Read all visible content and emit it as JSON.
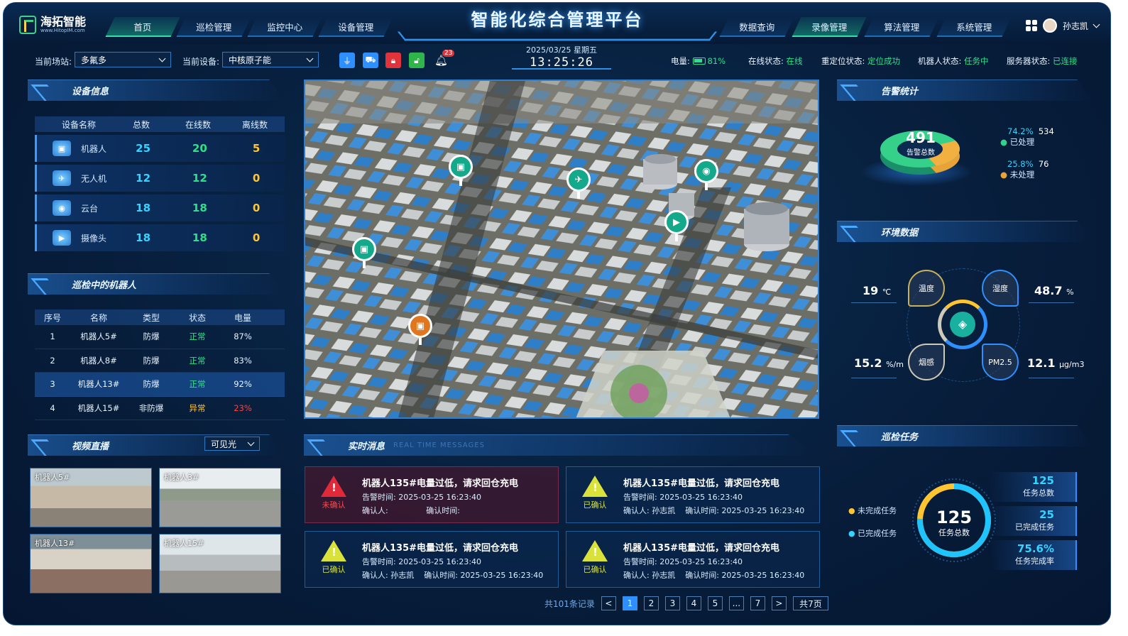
{
  "brand": {
    "name": "海拓智能",
    "url": "www.HitopIM.com"
  },
  "title": "智能化综合管理平台",
  "nav": {
    "left": [
      "首页",
      "巡检管理",
      "监控中心",
      "设备管理"
    ],
    "right": [
      "数据查询",
      "录像管理",
      "算法管理",
      "系统管理"
    ],
    "active": "首页",
    "active_right": "录像管理"
  },
  "user": {
    "name": "孙志凯"
  },
  "toolbar": {
    "site_label": "当前场站:",
    "site_value": "多氟多",
    "device_label": "当前设备:",
    "device_value": "中核原子能",
    "notification_count": "23"
  },
  "clock": {
    "date": "2025/03/25 星期五",
    "time": "13:25:26"
  },
  "status": {
    "power_label": "电量:",
    "power_value": "81%",
    "online_label": "在线状态:",
    "online_value": "在线",
    "relocate_label": "重定位状态:",
    "relocate_value": "定位成功",
    "robot_label": "机器人状态:",
    "robot_value": "任务中",
    "server_label": "服务器状态:",
    "server_value": "已连接"
  },
  "device_info": {
    "title": "设备信息",
    "headers": [
      "设备名称",
      "总数",
      "在线数",
      "离线数"
    ],
    "rows": [
      {
        "icon": "robot-icon",
        "name": "机器人",
        "total": "25",
        "online": "20",
        "offline": "5"
      },
      {
        "icon": "drone-icon",
        "name": "无人机",
        "total": "12",
        "online": "12",
        "offline": "0"
      },
      {
        "icon": "ptz-icon",
        "name": "云台",
        "total": "18",
        "online": "18",
        "offline": "0"
      },
      {
        "icon": "camera-icon",
        "name": "摄像头",
        "total": "18",
        "online": "18",
        "offline": "0"
      }
    ]
  },
  "robots": {
    "title": "巡检中的机器人",
    "headers": [
      "序号",
      "名称",
      "类型",
      "状态",
      "电量"
    ],
    "rows": [
      {
        "no": "1",
        "name": "机器人5#",
        "type": "防爆",
        "status": "正常",
        "power": "87%"
      },
      {
        "no": "2",
        "name": "机器人8#",
        "type": "防爆",
        "status": "正常",
        "power": "83%"
      },
      {
        "no": "3",
        "name": "机器人13#",
        "type": "防爆",
        "status": "正常",
        "power": "92%"
      },
      {
        "no": "4",
        "name": "机器人15#",
        "type": "非防爆",
        "status": "异常",
        "power": "23%"
      }
    ]
  },
  "video": {
    "title": "视频直播",
    "mode": "可见光",
    "feeds": [
      "机器人5#",
      "机器人3#",
      "机器人13#",
      "机器人15#"
    ]
  },
  "messages": {
    "title": "实时消息",
    "subtitle": "REAL TIME MESSAGES",
    "items": [
      {
        "state": "未确认",
        "title": "机器人135#电量过低，请求回仓充电",
        "line1": "告警时间:  2025-03-25  16:23:40",
        "confirm_label": "确认人:",
        "confirm_time_label": "确认时间:",
        "confirmer": "",
        "confirm_time": ""
      },
      {
        "state": "已确认",
        "title": "机器人135#电量过低，请求回仓充电",
        "line1": "告警时间:  2025-03-25  16:23:40",
        "confirm_label": "确认人:",
        "confirm_time_label": "确认时间:",
        "confirmer": "孙志凯",
        "confirm_time": "2025-03-25  16:23:40"
      },
      {
        "state": "已确认",
        "title": "机器人135#电量过低，请求回仓充电",
        "line1": "告警时间:  2025-03-25  16:23:40",
        "confirm_label": "确认人:",
        "confirm_time_label": "确认时间:",
        "confirmer": "孙志凯",
        "confirm_time": "2025-03-25  16:23:40"
      },
      {
        "state": "已确认",
        "title": "机器人135#电量过低，请求回仓充电",
        "line1": "告警时间:  2025-03-25  16:23:40",
        "confirm_label": "确认人:",
        "confirm_time_label": "确认时间:",
        "confirmer": "孙志凯",
        "confirm_time": "2025-03-25  16:23:40"
      }
    ]
  },
  "pagination": {
    "total": "共101条记录",
    "pages": [
      "1",
      "2",
      "3",
      "4",
      "5",
      "...",
      "7"
    ],
    "current": "1",
    "page_count": "共7页",
    "prev": "<",
    "next": ">"
  },
  "alarm": {
    "title": "告警统计",
    "total": "491",
    "total_label": "告警总数",
    "handled_pct": "74.2%",
    "handled_count": "534",
    "handled_label": "已处理",
    "unhandled_pct": "25.8%",
    "unhandled_count": "76",
    "unhandled_label": "未处理",
    "handled_fraction": 0.742
  },
  "env": {
    "title": "环境数据",
    "temp": "19",
    "temp_unit": "℃",
    "humidity": "48.7",
    "humidity_unit": "%",
    "wind": "15.2",
    "wind_unit": "%/m",
    "pm": "12.1",
    "pm_unit": "μg/m3",
    "petals": [
      "温度",
      "湿度",
      "烟感",
      "PM2.5"
    ]
  },
  "task": {
    "title": "巡检任务",
    "total": "125",
    "total_label": "任务总数",
    "done": "25",
    "done_label": "已完成任务",
    "rate": "75.6%",
    "rate_label": "任务完成率",
    "legend_unfinished": "未完成任务",
    "legend_finished": "已完成任务",
    "done_fraction": 0.756
  },
  "colors": {
    "accent": "#2e8fff",
    "green": "#2fe08a",
    "yellow": "#ffc530",
    "red": "#ff4040"
  }
}
